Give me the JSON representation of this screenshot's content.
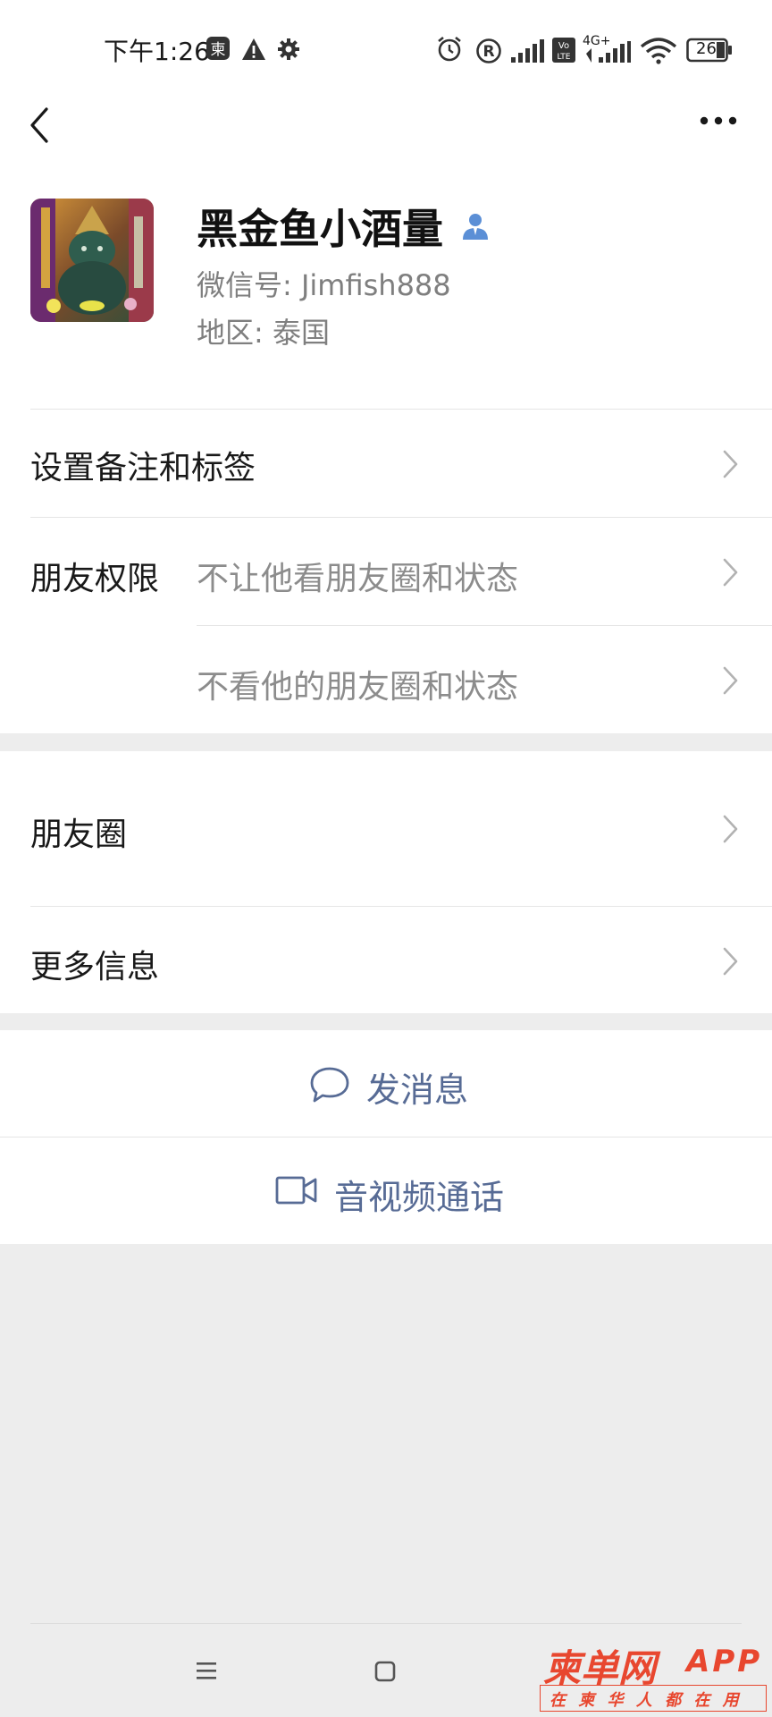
{
  "status_bar": {
    "time": "下午1:26",
    "battery": "26",
    "network": "4G+",
    "volte": "Vo LTE"
  },
  "nav": {
    "back_icon": "chevron-left-icon",
    "more_icon": "more-dots-icon"
  },
  "profile": {
    "nickname": "黑金鱼小酒量",
    "wechat_id": "微信号: Jimfish888",
    "region": "地区: 泰国"
  },
  "rows": {
    "remark_tags": "设置备注和标签",
    "friend_permissions": "朋友权限",
    "permission_1": "不让他看朋友圈和状态",
    "permission_2": "不看他的朋友圈和状态",
    "moments": "朋友圈",
    "more_info": "更多信息"
  },
  "actions": {
    "send_message": "发消息",
    "voice_video_call": "音视频通话"
  },
  "watermark": {
    "brand": "柬单网",
    "app": "APP",
    "slogan": "在 柬 华 人 都 在 用"
  },
  "colors": {
    "link_blue": "#576b95",
    "background": "#ededed",
    "watermark_red": "#e8472f"
  }
}
